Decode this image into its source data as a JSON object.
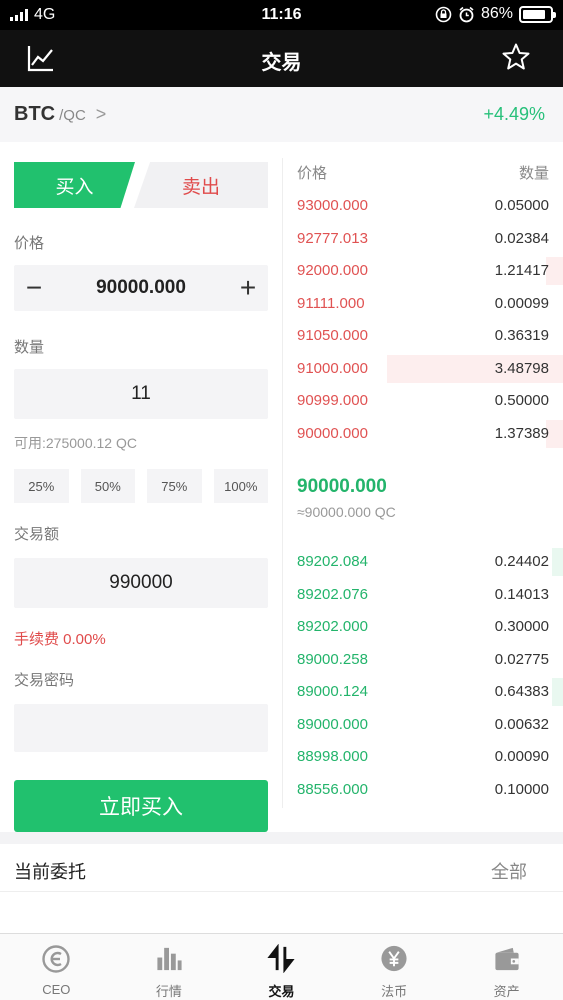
{
  "status_bar": {
    "carrier": "4G",
    "time": "11:16",
    "battery": "86%",
    "battery_level": 0.86
  },
  "header": {
    "title": "交易",
    "left_icon": "chart-line-icon",
    "right_icon": "star-icon"
  },
  "pair": {
    "base": "BTC",
    "quote": "/QC",
    "chevron": ">",
    "change": "+4.49%"
  },
  "form": {
    "buy_tab": "买入",
    "sell_tab": "卖出",
    "price_label": "价格",
    "price_value": "90000.000",
    "minus": "−",
    "plus": "+",
    "amount_label": "数量",
    "amount_value": "11",
    "available": "可用:275000.12 QC",
    "percents": [
      "25%",
      "50%",
      "75%",
      "100%"
    ],
    "total_label": "交易额",
    "total_value": "990000",
    "fee": "手续费 0.00%",
    "password_label": "交易密码",
    "password_value": "",
    "submit": "立即买入"
  },
  "book": {
    "price_header": "价格",
    "qty_header": "数量",
    "asks": [
      {
        "price": "93000.000",
        "qty": "0.05000",
        "depth": 0.0
      },
      {
        "price": "92777.013",
        "qty": "0.02384",
        "depth": 0.0
      },
      {
        "price": "92000.000",
        "qty": "1.21417",
        "depth": 0.06
      },
      {
        "price": "91111.000",
        "qty": "0.00099",
        "depth": 0.0
      },
      {
        "price": "91050.000",
        "qty": "0.36319",
        "depth": 0.0
      },
      {
        "price": "91000.000",
        "qty": "3.48798",
        "depth": 0.63
      },
      {
        "price": "90999.000",
        "qty": "0.50000",
        "depth": 0.0
      },
      {
        "price": "90000.000",
        "qty": "1.37389",
        "depth": 0.06
      }
    ],
    "last_price": "90000.000",
    "last_price_sub": "≈90000.000 QC",
    "bids": [
      {
        "price": "89202.084",
        "qty": "0.24402",
        "depth": 0.04
      },
      {
        "price": "89202.076",
        "qty": "0.14013",
        "depth": 0.0
      },
      {
        "price": "89202.000",
        "qty": "0.30000",
        "depth": 0.0
      },
      {
        "price": "89000.258",
        "qty": "0.02775",
        "depth": 0.0
      },
      {
        "price": "89000.124",
        "qty": "0.64383",
        "depth": 0.04
      },
      {
        "price": "89000.000",
        "qty": "0.00632",
        "depth": 0.0
      },
      {
        "price": "88998.000",
        "qty": "0.00090",
        "depth": 0.0
      },
      {
        "price": "88556.000",
        "qty": "0.10000",
        "depth": 0.0
      }
    ]
  },
  "orders": {
    "title": "当前委托",
    "all": "全部"
  },
  "tabbar": [
    {
      "label": "CEO",
      "icon": "ceo-logo-icon"
    },
    {
      "label": "行情",
      "icon": "bar-chart-icon"
    },
    {
      "label": "交易",
      "icon": "trade-arrows-icon"
    },
    {
      "label": "法币",
      "icon": "yen-coin-icon"
    },
    {
      "label": "资产",
      "icon": "wallet-icon"
    }
  ],
  "colors": {
    "green": "#21c16e",
    "red": "#e04b4b",
    "header_bg": "#111111"
  }
}
